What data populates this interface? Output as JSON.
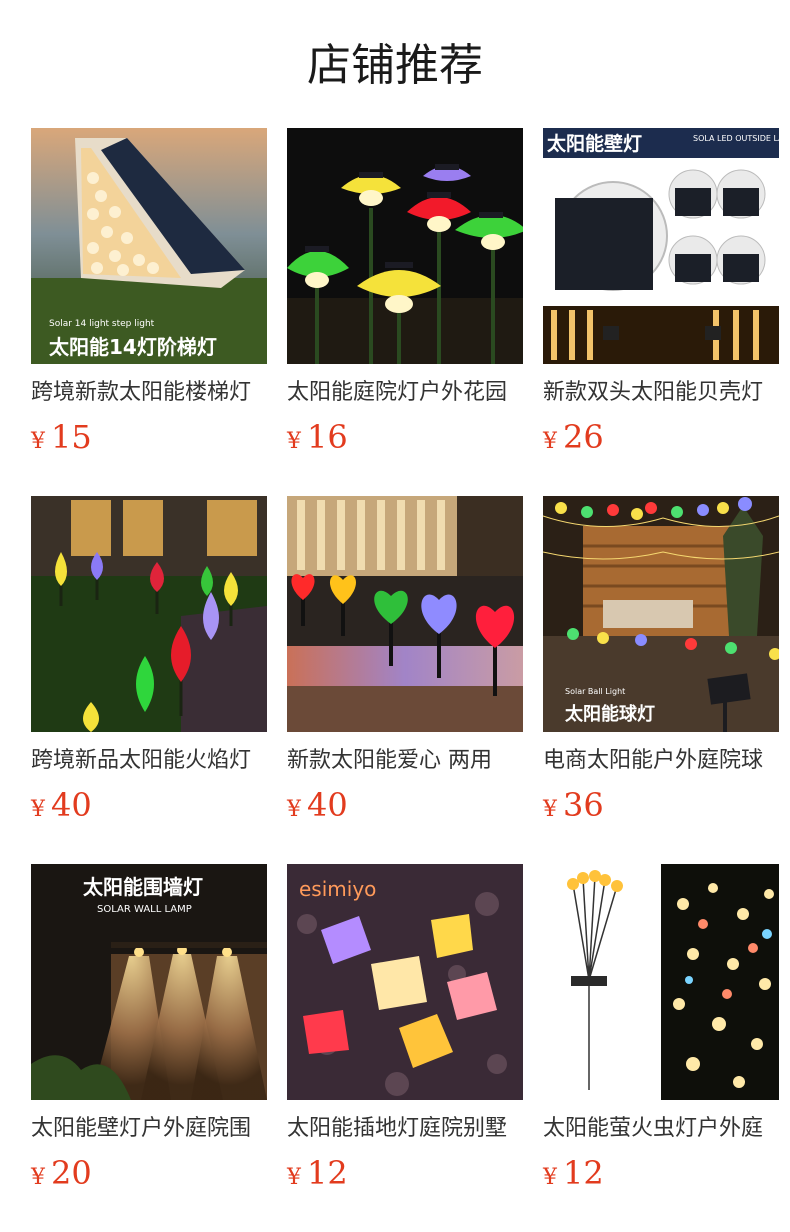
{
  "header": {
    "title": "店铺推荐"
  },
  "currency_symbol": "¥",
  "colors": {
    "price": "#e23b1e",
    "title": "#1a1a1a",
    "name": "#333333"
  },
  "products": [
    {
      "name": "跨境新款太阳能楼梯灯",
      "price": "15",
      "img_text": "太阳能14灯阶梯灯",
      "img_subtext": "Solar 14 light step light"
    },
    {
      "name": "太阳能庭院灯户外花园",
      "price": "16"
    },
    {
      "name": "新款双头太阳能贝壳灯",
      "price": "26",
      "img_text": "太阳能壁灯",
      "img_subtext": "SOLA LED OUTSIDE LAMP"
    },
    {
      "name": "跨境新品太阳能火焰灯",
      "price": "40"
    },
    {
      "name": "新款太阳能爱心 两用",
      "price": "40"
    },
    {
      "name": "电商太阳能户外庭院球",
      "price": "36",
      "img_text": "太阳能球灯",
      "img_subtext": "Solar Ball Light"
    },
    {
      "name": "太阳能壁灯户外庭院围",
      "price": "20",
      "img_text": "太阳能围墙灯",
      "img_subtext": "SOLAR WALL LAMP"
    },
    {
      "name": "太阳能插地灯庭院别墅",
      "price": "12",
      "img_text": "esimiyo"
    },
    {
      "name": "太阳能萤火虫灯户外庭",
      "price": "12"
    }
  ]
}
